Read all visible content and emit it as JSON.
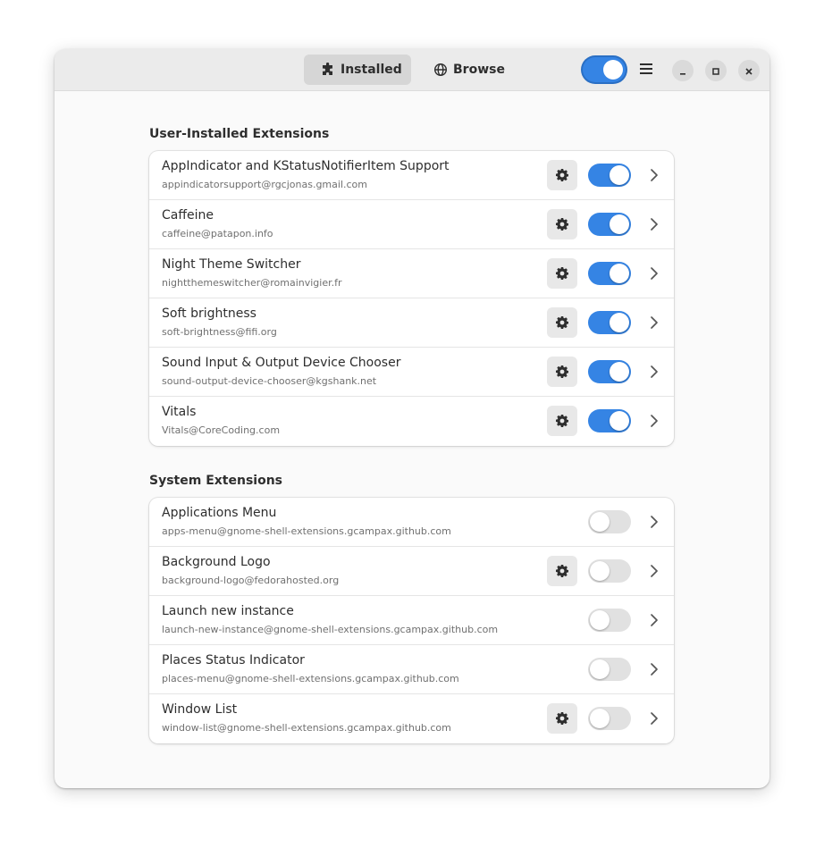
{
  "header": {
    "tabs": [
      {
        "label": "Installed",
        "icon": "puzzle-icon",
        "active": true
      },
      {
        "label": "Browse",
        "icon": "globe-icon",
        "active": false
      }
    ],
    "global_toggle_on": true,
    "accent_color": "#3584e4"
  },
  "sections": [
    {
      "title": "User-Installed Extensions",
      "items": [
        {
          "name": "AppIndicator and KStatusNotifierItem Support",
          "uuid": "appindicatorsupport@rgcjonas.gmail.com",
          "has_settings": true,
          "enabled": true
        },
        {
          "name": "Caffeine",
          "uuid": "caffeine@patapon.info",
          "has_settings": true,
          "enabled": true
        },
        {
          "name": "Night Theme Switcher",
          "uuid": "nightthemeswitcher@romainvigier.fr",
          "has_settings": true,
          "enabled": true
        },
        {
          "name": "Soft brightness",
          "uuid": "soft-brightness@fifi.org",
          "has_settings": true,
          "enabled": true
        },
        {
          "name": "Sound Input & Output Device Chooser",
          "uuid": "sound-output-device-chooser@kgshank.net",
          "has_settings": true,
          "enabled": true
        },
        {
          "name": "Vitals",
          "uuid": "Vitals@CoreCoding.com",
          "has_settings": true,
          "enabled": true
        }
      ]
    },
    {
      "title": "System Extensions",
      "items": [
        {
          "name": "Applications Menu",
          "uuid": "apps-menu@gnome-shell-extensions.gcampax.github.com",
          "has_settings": false,
          "enabled": false
        },
        {
          "name": "Background Logo",
          "uuid": "background-logo@fedorahosted.org",
          "has_settings": true,
          "enabled": false
        },
        {
          "name": "Launch new instance",
          "uuid": "launch-new-instance@gnome-shell-extensions.gcampax.github.com",
          "has_settings": false,
          "enabled": false
        },
        {
          "name": "Places Status Indicator",
          "uuid": "places-menu@gnome-shell-extensions.gcampax.github.com",
          "has_settings": false,
          "enabled": false
        },
        {
          "name": "Window List",
          "uuid": "window-list@gnome-shell-extensions.gcampax.github.com",
          "has_settings": true,
          "enabled": false
        }
      ]
    }
  ]
}
